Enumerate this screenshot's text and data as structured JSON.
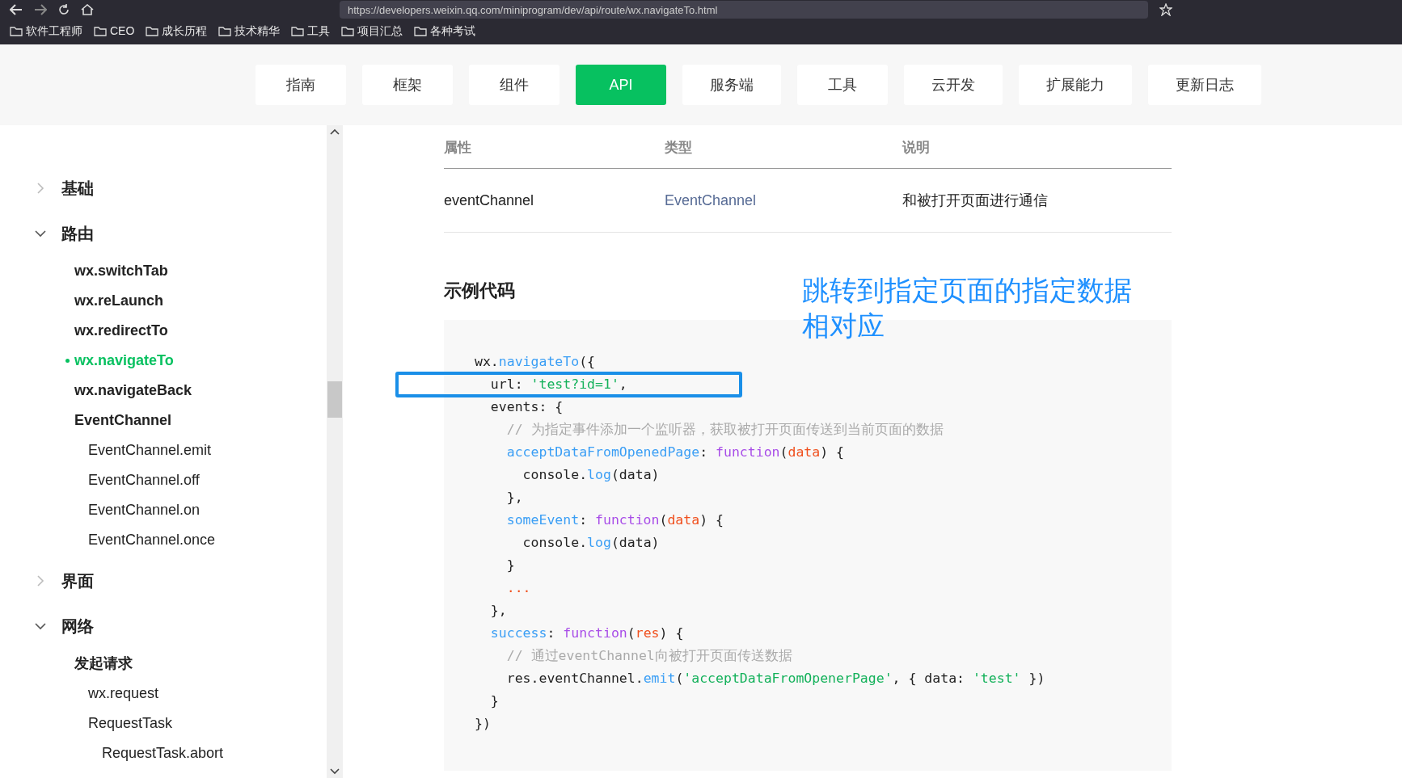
{
  "browser": {
    "url": "https://developers.weixin.qq.com/miniprogram/dev/api/route/wx.navigateTo.html",
    "bookmarks": [
      "软件工程师",
      "CEO",
      "成长历程",
      "技术精华",
      "工具",
      "项目汇总",
      "各种考试"
    ]
  },
  "nav_tabs": [
    {
      "label": "指南",
      "selected": false
    },
    {
      "label": "框架",
      "selected": false
    },
    {
      "label": "组件",
      "selected": false
    },
    {
      "label": "API",
      "selected": true
    },
    {
      "label": "服务端",
      "selected": false
    },
    {
      "label": "工具",
      "selected": false
    },
    {
      "label": "云开发",
      "selected": false
    },
    {
      "label": "扩展能力",
      "selected": false
    },
    {
      "label": "更新日志",
      "selected": false
    }
  ],
  "sidebar": [
    {
      "label": "基础",
      "expanded": false
    },
    {
      "label": "路由",
      "expanded": true,
      "children": [
        {
          "label": "wx.switchTab",
          "selected": false
        },
        {
          "label": "wx.reLaunch",
          "selected": false
        },
        {
          "label": "wx.redirectTo",
          "selected": false
        },
        {
          "label": "wx.navigateTo",
          "selected": true
        },
        {
          "label": "wx.navigateBack",
          "selected": false
        },
        {
          "label": "EventChannel",
          "selected": false,
          "children": [
            {
              "label": "EventChannel.emit",
              "selected": false
            },
            {
              "label": "EventChannel.off",
              "selected": false
            },
            {
              "label": "EventChannel.on",
              "selected": false
            },
            {
              "label": "EventChannel.once",
              "selected": false
            }
          ]
        }
      ]
    },
    {
      "label": "界面",
      "expanded": false
    },
    {
      "label": "网络",
      "expanded": true,
      "children": [
        {
          "label": "发起请求",
          "selected": false,
          "children": [
            {
              "label": "wx.request",
              "selected": false
            },
            {
              "label": "RequestTask",
              "selected": false,
              "children": [
                {
                  "label": "RequestTask.abort",
                  "selected": false
                }
              ]
            }
          ]
        }
      ]
    }
  ],
  "table": {
    "columns": [
      "属性",
      "类型",
      "说明"
    ],
    "rows": [
      [
        {
          "text": "eventChannel",
          "kind": "plain"
        },
        {
          "text": "EventChannel",
          "kind": "link"
        },
        {
          "text": "和被打开页面进行通信",
          "kind": "plain"
        }
      ]
    ]
  },
  "section_title": "示例代码",
  "annotation": "跳转到指定页面的指定数据相对应",
  "code": [
    {
      "highlighted": false,
      "tokens": [
        {
          "kind": "plain",
          "text": "wx."
        },
        {
          "kind": "fn",
          "text": "navigateTo"
        },
        {
          "kind": "plain",
          "text": "({"
        }
      ]
    },
    {
      "highlighted": true,
      "tokens": [
        {
          "kind": "plain",
          "text": "  url: "
        },
        {
          "kind": "str",
          "text": "'test?id=1'"
        },
        {
          "kind": "plain",
          "text": ","
        }
      ]
    },
    {
      "highlighted": false,
      "tokens": [
        {
          "kind": "plain",
          "text": "  events: {"
        }
      ]
    },
    {
      "highlighted": false,
      "tokens": [
        {
          "kind": "comment",
          "text": "    // 为指定事件添加一个监听器，获取被打开页面传送到当前页面的数据"
        }
      ]
    },
    {
      "highlighted": false,
      "tokens": [
        {
          "kind": "fn",
          "text": "    acceptDataFromOpenedPage"
        },
        {
          "kind": "plain",
          "text": ": "
        },
        {
          "kind": "kw",
          "text": "function"
        },
        {
          "kind": "plain",
          "text": "("
        },
        {
          "kind": "param",
          "text": "data"
        },
        {
          "kind": "plain",
          "text": ") {"
        }
      ]
    },
    {
      "highlighted": false,
      "tokens": [
        {
          "kind": "plain",
          "text": "      console."
        },
        {
          "kind": "fn",
          "text": "log"
        },
        {
          "kind": "plain",
          "text": "(data)"
        }
      ]
    },
    {
      "highlighted": false,
      "tokens": [
        {
          "kind": "plain",
          "text": "    },"
        }
      ]
    },
    {
      "highlighted": false,
      "tokens": [
        {
          "kind": "fn",
          "text": "    someEvent"
        },
        {
          "kind": "plain",
          "text": ": "
        },
        {
          "kind": "kw",
          "text": "function"
        },
        {
          "kind": "plain",
          "text": "("
        },
        {
          "kind": "param",
          "text": "data"
        },
        {
          "kind": "plain",
          "text": ") {"
        }
      ]
    },
    {
      "highlighted": false,
      "tokens": [
        {
          "kind": "plain",
          "text": "      console."
        },
        {
          "kind": "fn",
          "text": "log"
        },
        {
          "kind": "plain",
          "text": "(data)"
        }
      ]
    },
    {
      "highlighted": false,
      "tokens": [
        {
          "kind": "plain",
          "text": "    }"
        }
      ]
    },
    {
      "highlighted": false,
      "tokens": [
        {
          "kind": "param",
          "text": "    ..."
        }
      ]
    },
    {
      "highlighted": false,
      "tokens": [
        {
          "kind": "plain",
          "text": "  },"
        }
      ]
    },
    {
      "highlighted": false,
      "tokens": [
        {
          "kind": "fn",
          "text": "  success"
        },
        {
          "kind": "plain",
          "text": ": "
        },
        {
          "kind": "kw",
          "text": "function"
        },
        {
          "kind": "plain",
          "text": "("
        },
        {
          "kind": "param",
          "text": "res"
        },
        {
          "kind": "plain",
          "text": ") {"
        }
      ]
    },
    {
      "highlighted": false,
      "tokens": [
        {
          "kind": "comment",
          "text": "    // 通过eventChannel向被打开页面传送数据"
        }
      ]
    },
    {
      "highlighted": false,
      "tokens": [
        {
          "kind": "plain",
          "text": "    res.eventChannel."
        },
        {
          "kind": "fn",
          "text": "emit"
        },
        {
          "kind": "plain",
          "text": "("
        },
        {
          "kind": "str",
          "text": "'acceptDataFromOpenerPage'"
        },
        {
          "kind": "plain",
          "text": ", { data: "
        },
        {
          "kind": "str",
          "text": "'test'"
        },
        {
          "kind": "plain",
          "text": " })"
        }
      ]
    },
    {
      "highlighted": false,
      "tokens": [
        {
          "kind": "plain",
          "text": "  }"
        }
      ]
    },
    {
      "highlighted": false,
      "tokens": [
        {
          "kind": "plain",
          "text": "})"
        }
      ]
    }
  ]
}
